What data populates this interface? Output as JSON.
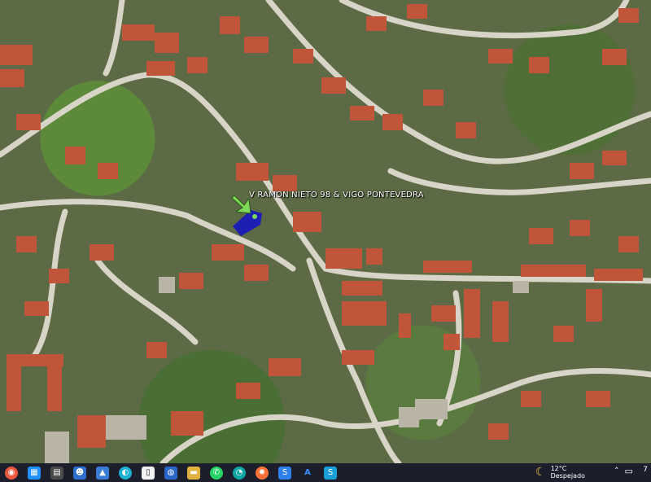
{
  "map": {
    "placemark_label": "V RAMON NIETO 98 & VIGO PONTEVEDRA",
    "colors": {
      "roads": "#d8d4c8",
      "roofs": "#c1553a",
      "vegetation": "#5c6a45",
      "parcel": "#1010c8",
      "arrow": "#7dd85a"
    }
  },
  "taskbar": {
    "icons": [
      "start-icon",
      "store-icon",
      "edge-icon",
      "people-icon",
      "photos-icon",
      "browser-icon",
      "file-icon",
      "file-explorer-icon",
      "explorer-icon",
      "whatsapp-icon",
      "edge-beta-icon",
      "firefox-icon",
      "sigil-icon",
      "app-a-icon",
      "app-s-icon"
    ],
    "weather": {
      "temp": "12°C",
      "condition": "Despejado"
    },
    "clock": "7"
  }
}
